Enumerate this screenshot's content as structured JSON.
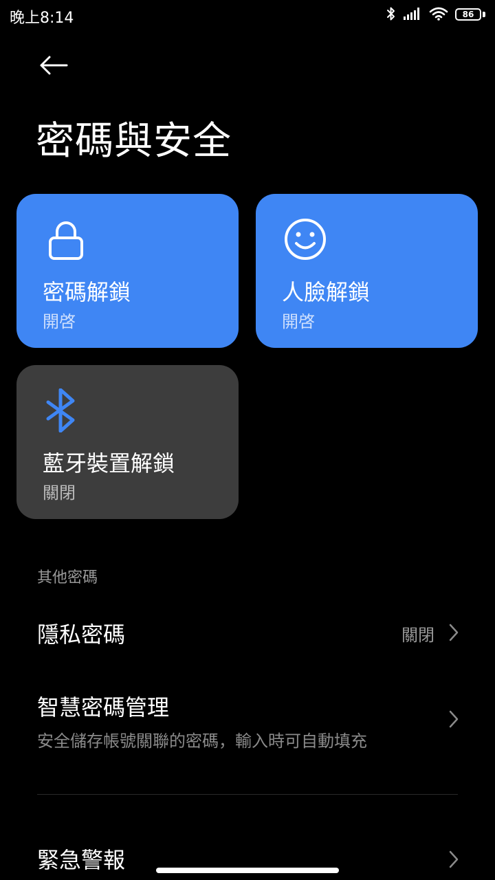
{
  "status_bar": {
    "time": "晚上8:14",
    "battery": "86",
    "icons": [
      "bluetooth-icon",
      "signal-icon",
      "wifi-icon",
      "battery-icon"
    ]
  },
  "header": {
    "title": "密碼與安全",
    "back_icon": "back-arrow-icon"
  },
  "tiles": [
    {
      "label": "密碼解鎖",
      "status": "開啓",
      "icon": "lock-icon",
      "state": "on"
    },
    {
      "label": "人臉解鎖",
      "status": "開啓",
      "icon": "face-icon",
      "state": "on"
    },
    {
      "label": "藍牙裝置解鎖",
      "status": "關閉",
      "icon": "bluetooth-icon",
      "state": "off"
    }
  ],
  "other_passwords": {
    "header": "其他密碼",
    "items": [
      {
        "title": "隱私密碼",
        "value": "關閉"
      },
      {
        "title": "智慧密碼管理",
        "subtitle": "安全儲存帳號關聯的密碼，輸入時可自動填充"
      }
    ]
  },
  "bottom_item": {
    "title": "緊急警報"
  },
  "colors": {
    "background": "#000000",
    "tile_active": "#3f86f4",
    "tile_inactive": "#3d3d3d",
    "bluetooth_accent": "#3f86f4"
  }
}
